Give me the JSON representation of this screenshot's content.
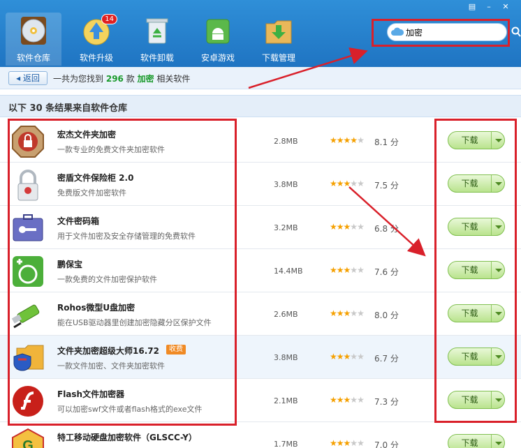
{
  "window": {
    "menu_icon": "menu-icon",
    "min_icon": "minimize-icon",
    "close_icon": "close-icon"
  },
  "nav": [
    {
      "label": "软件仓库",
      "icon": "disc-icon",
      "active": true
    },
    {
      "label": "软件升级",
      "icon": "upgrade-icon",
      "badge": "14"
    },
    {
      "label": "软件卸载",
      "icon": "recycle-icon"
    },
    {
      "label": "安卓游戏",
      "icon": "android-icon"
    },
    {
      "label": "下载管理",
      "icon": "download-folder-icon"
    }
  ],
  "search": {
    "value": "加密",
    "icon": "cloud-icon",
    "button_icon": "search-icon"
  },
  "result": {
    "back_label": "返回",
    "prefix": "一共为您找到",
    "count": "296",
    "mid": "款",
    "keyword": "加密",
    "suffix": "相关软件"
  },
  "section": {
    "title": "以下 30 条结果来自软件仓库"
  },
  "download_label": "下载",
  "apps": [
    {
      "name": "宏杰文件夹加密",
      "desc": "一款专业的免费文件夹加密软件",
      "size": "2.8MB",
      "rating": 4,
      "score": "8.1 分",
      "icon": "lock-badge-icon"
    },
    {
      "name": "密盾文件保险柜 2.0",
      "desc": "免费版文件加密软件",
      "size": "3.8MB",
      "rating": 3,
      "score": "7.5 分",
      "icon": "padlock-icon"
    },
    {
      "name": "文件密码箱",
      "desc": "用于文件加密及安全存储管理的免费软件",
      "size": "3.2MB",
      "rating": 3,
      "score": "6.8 分",
      "icon": "key-case-icon"
    },
    {
      "name": "鹏保宝",
      "desc": "一款免费的文件加密保护软件",
      "size": "14.4MB",
      "rating": 3,
      "score": "7.6 分",
      "icon": "green-shield-icon"
    },
    {
      "name": "Rohos微型U盘加密",
      "desc": "能在USB驱动器里创建加密隐藏分区保护文件",
      "size": "2.6MB",
      "rating": 3,
      "score": "8.0 分",
      "icon": "usb-drive-icon"
    },
    {
      "name": "文件夹加密超级大师16.72",
      "tag": "收费",
      "desc": "一款文件加密、文件夹加密软件",
      "size": "3.8MB",
      "rating": 3,
      "score": "6.7 分",
      "icon": "folder-shield-icon"
    },
    {
      "name": "Flash文件加密器",
      "desc": "可以加密swf文件或者flash格式的exe文件",
      "size": "2.1MB",
      "rating": 3,
      "score": "7.3 分",
      "icon": "flash-icon"
    },
    {
      "name": "特工移动硬盘加密软件（GLSCC-Y）",
      "desc": "",
      "size": "1.7MB",
      "rating": 3,
      "score": "7.0 分",
      "icon": "g-badge-icon"
    }
  ],
  "colors": {
    "toolbar": "#1f74c2",
    "highlight": "#1a9a2c",
    "annotation": "#d9202a",
    "star": "#f5a000"
  }
}
